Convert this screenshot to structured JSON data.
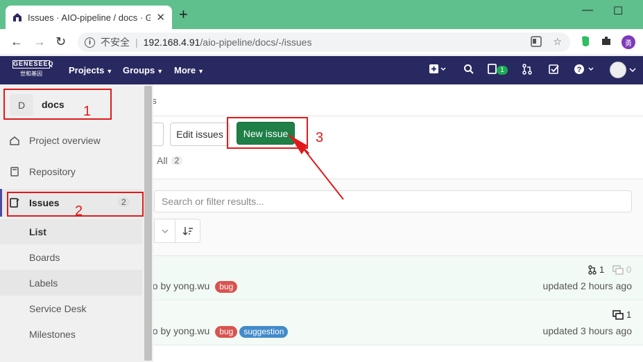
{
  "browser": {
    "tab_title": "Issues · AIO-pipeline / docs · G",
    "tab_close": "✕",
    "new_tab": "+",
    "win_min": "—",
    "win_max": "☐",
    "back": "←",
    "forward": "→",
    "reload": "↻",
    "insecure_label": "不安全",
    "url_host": "192.168.4.91",
    "url_path": "/aio-pipeline/docs/-/issues",
    "profile_initial": "勇"
  },
  "gitlab_header": {
    "logo_text": "世和基因",
    "logo_word": "GENESEEQ",
    "nav": [
      {
        "label": "Projects"
      },
      {
        "label": "Groups"
      },
      {
        "label": "More"
      }
    ],
    "todo_count": "1"
  },
  "sidebar": {
    "project_initial": "D",
    "project_name": "docs",
    "items": [
      {
        "label": "Project overview"
      },
      {
        "label": "Repository"
      },
      {
        "label": "Issues",
        "count": "2"
      }
    ],
    "sub_items": [
      {
        "label": "List"
      },
      {
        "label": "Boards"
      },
      {
        "label": "Labels"
      },
      {
        "label": "Service Desk"
      },
      {
        "label": "Milestones"
      }
    ]
  },
  "main": {
    "breadcrumb": "es",
    "edit_issues_label": "Edit issues",
    "new_issue_label": "New issue",
    "tab_all_label": "All",
    "tab_all_count": "2",
    "search_placeholder": "Search or filter results...",
    "issues": [
      {
        "meta_prefix": "go by ",
        "author": "yong.wu",
        "labels": [
          {
            "text": "bug",
            "color": "#d9534f"
          }
        ],
        "mr_count": "1",
        "comment_count": "0",
        "updated": "updated 2 hours ago"
      },
      {
        "meta_prefix": "go by ",
        "author": "yong.wu",
        "labels": [
          {
            "text": "bug",
            "color": "#d9534f"
          },
          {
            "text": "suggestion",
            "color": "#428bca"
          }
        ],
        "comment_count": "1",
        "updated": "updated 3 hours ago"
      }
    ]
  },
  "annotations": [
    "1",
    "2",
    "3"
  ],
  "colors": {
    "header": "#292961",
    "new_issue": "#1f7f47",
    "annotation": "#e0191a",
    "tabstrip": "#5fbf8d"
  }
}
